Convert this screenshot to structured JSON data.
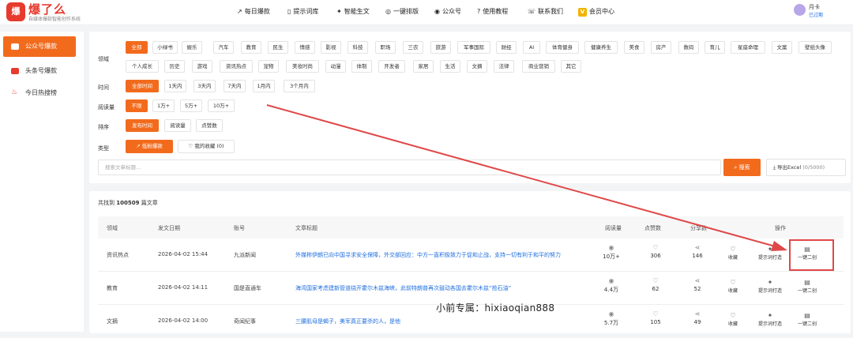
{
  "brand": {
    "logo_text": "爆",
    "name": "爆了么",
    "slogan": "自媒体爆款智能创作系统"
  },
  "nav": [
    {
      "icon": "trend-icon",
      "label": "每日爆款"
    },
    {
      "icon": "book-icon",
      "label": "提示词库"
    },
    {
      "icon": "sparkle-icon",
      "label": "智能生文"
    },
    {
      "icon": "palette-icon",
      "label": "一键排版"
    },
    {
      "icon": "broadcast-icon",
      "label": "公众号"
    },
    {
      "icon": "help-icon",
      "label": "使用教程"
    },
    {
      "icon": "phone-icon",
      "label": "联系我们"
    },
    {
      "icon": "vip-icon",
      "label": "会员中心",
      "badge": "V"
    }
  ],
  "user": {
    "name": "月卡",
    "status": "已过期"
  },
  "sidebar": [
    {
      "label": "公众号爆款",
      "active": true,
      "icon_color": "#2fb55b"
    },
    {
      "label": "头条号爆款",
      "active": false,
      "icon_color": "#e63b2e"
    },
    {
      "label": "今日热搜榜",
      "active": false,
      "icon_color": "#e63b2e"
    }
  ],
  "filters": {
    "domain_label": "领域",
    "domain_row1": [
      "全部",
      "小绿书",
      "娱乐",
      "汽车",
      "教育",
      "民生",
      "情感",
      "影视",
      "科技",
      "职场",
      "三农",
      "旅游",
      "军事国际",
      "财经",
      "AI",
      "体育健身",
      "健康养生",
      "美食",
      "房产",
      "数码",
      "育儿",
      "星座命理",
      "文案",
      "壁纸头像"
    ],
    "domain_row2": [
      "个人成长",
      "历史",
      "游戏",
      "资讯热点",
      "宠物",
      "美妆时尚",
      "动漫",
      "体制",
      "开发者",
      "家居",
      "生活",
      "文摘",
      "法律",
      "商业营销",
      "其它"
    ],
    "domain_selected": "全部",
    "time_label": "时间",
    "time_options": [
      "全部时间",
      "1天内",
      "3天内",
      "7天内",
      "1月内",
      "3个月内"
    ],
    "time_selected": "全部时间",
    "reads_label": "阅读量",
    "reads_options": [
      "不限",
      "1万+",
      "5万+",
      "10万+"
    ],
    "reads_selected": "不限",
    "sort_label": "排序",
    "sort_options": [
      "发布时间",
      "阅读量",
      "点赞数"
    ],
    "sort_selected": "发布时间",
    "type_label": "类型",
    "type_options": [
      "低粉爆款",
      "我的收藏 (0)"
    ],
    "type_selected": "低粉爆款"
  },
  "search": {
    "placeholder": "搜索文章标题...",
    "button": "搜索",
    "export_label": "导出Excel",
    "export_count": "(0/5000)"
  },
  "results": {
    "prefix": "共找到",
    "count": "100509",
    "suffix": "篇文章",
    "columns": [
      "领域",
      "发文日期",
      "账号",
      "文章标题",
      "阅读量",
      "点赞数",
      "分享数",
      "操作"
    ],
    "rows": [
      {
        "domain": "资讯热点",
        "date": "2026-04-02 15:44",
        "account": "九派新闻",
        "title": "外媒称伊朗已向中国寻求安全保障，外交部回应：中方一直积极致力于促和止战，支持一切有利于和平的努力",
        "reads": "10万+",
        "likes": "306",
        "shares": "146"
      },
      {
        "domain": "教育",
        "date": "2026-04-02 14:11",
        "account": "国是直通车",
        "title": "海湾国家考虑建新管道绕开霍尔木兹海峡，此前特朗普再次鼓动各国去霍尔木兹“抢石油”",
        "reads": "4.4万",
        "likes": "62",
        "shares": "52"
      },
      {
        "domain": "文摘",
        "date": "2026-04-02 14:00",
        "account": "奇闻纪事",
        "title": "三腰肌母是蝎子，美军真正要杀的人，是他",
        "reads": "5.7万",
        "likes": "105",
        "shares": "49"
      }
    ],
    "actions": [
      "收藏",
      "提示词打造",
      "一键二创"
    ]
  },
  "watermark": "小前专属：hixiaoqian888",
  "colors": {
    "accent": "#f26b1d",
    "brand_red": "#e63b2e",
    "link": "#1e6ee0",
    "annotation": "#e04848"
  }
}
